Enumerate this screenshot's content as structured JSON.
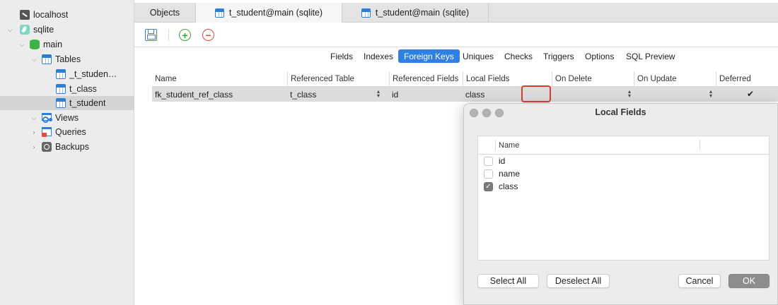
{
  "sidebar": {
    "items": [
      {
        "label": "localhost",
        "icon": "server-icon"
      },
      {
        "label": "sqlite",
        "icon": "sqlite-feather-icon"
      },
      {
        "label": "main",
        "icon": "database-icon"
      },
      {
        "label": "Tables",
        "icon": "tables-icon"
      },
      {
        "label": "_t_student_old",
        "icon": "table-icon"
      },
      {
        "label": "t_class",
        "icon": "table-icon"
      },
      {
        "label": "t_student",
        "icon": "table-icon"
      },
      {
        "label": "Views",
        "icon": "views-icon"
      },
      {
        "label": "Queries",
        "icon": "queries-icon"
      },
      {
        "label": "Backups",
        "icon": "backups-icon"
      }
    ]
  },
  "tabs": [
    {
      "label": "Objects"
    },
    {
      "label": "t_student@main (sqlite)"
    },
    {
      "label": "t_student@main (sqlite)"
    }
  ],
  "subtabs": [
    "Fields",
    "Indexes",
    "Foreign Keys",
    "Uniques",
    "Checks",
    "Triggers",
    "Options",
    "SQL Preview"
  ],
  "active_subtab": "Foreign Keys",
  "grid": {
    "columns": [
      "Name",
      "Referenced Table",
      "Referenced Fields",
      "Local Fields",
      "On Delete",
      "On Update",
      "Deferred"
    ],
    "row": {
      "name": "fk_student_ref_class",
      "referenced_table": "t_class",
      "referenced_fields": "id",
      "local_fields": "class",
      "on_delete": "",
      "on_update": "",
      "deferred": true
    }
  },
  "dialog": {
    "title": "Local Fields",
    "column_name": "Name",
    "items": [
      {
        "label": "id",
        "checked": false
      },
      {
        "label": "name",
        "checked": false
      },
      {
        "label": "class",
        "checked": true
      }
    ],
    "select_all": "Select All",
    "deselect_all": "Deselect All",
    "cancel": "Cancel",
    "ok": "OK"
  },
  "colors": {
    "accent": "#2f80e4",
    "highlight": "#e03a2e",
    "selected_row": "#dcdcdc"
  }
}
